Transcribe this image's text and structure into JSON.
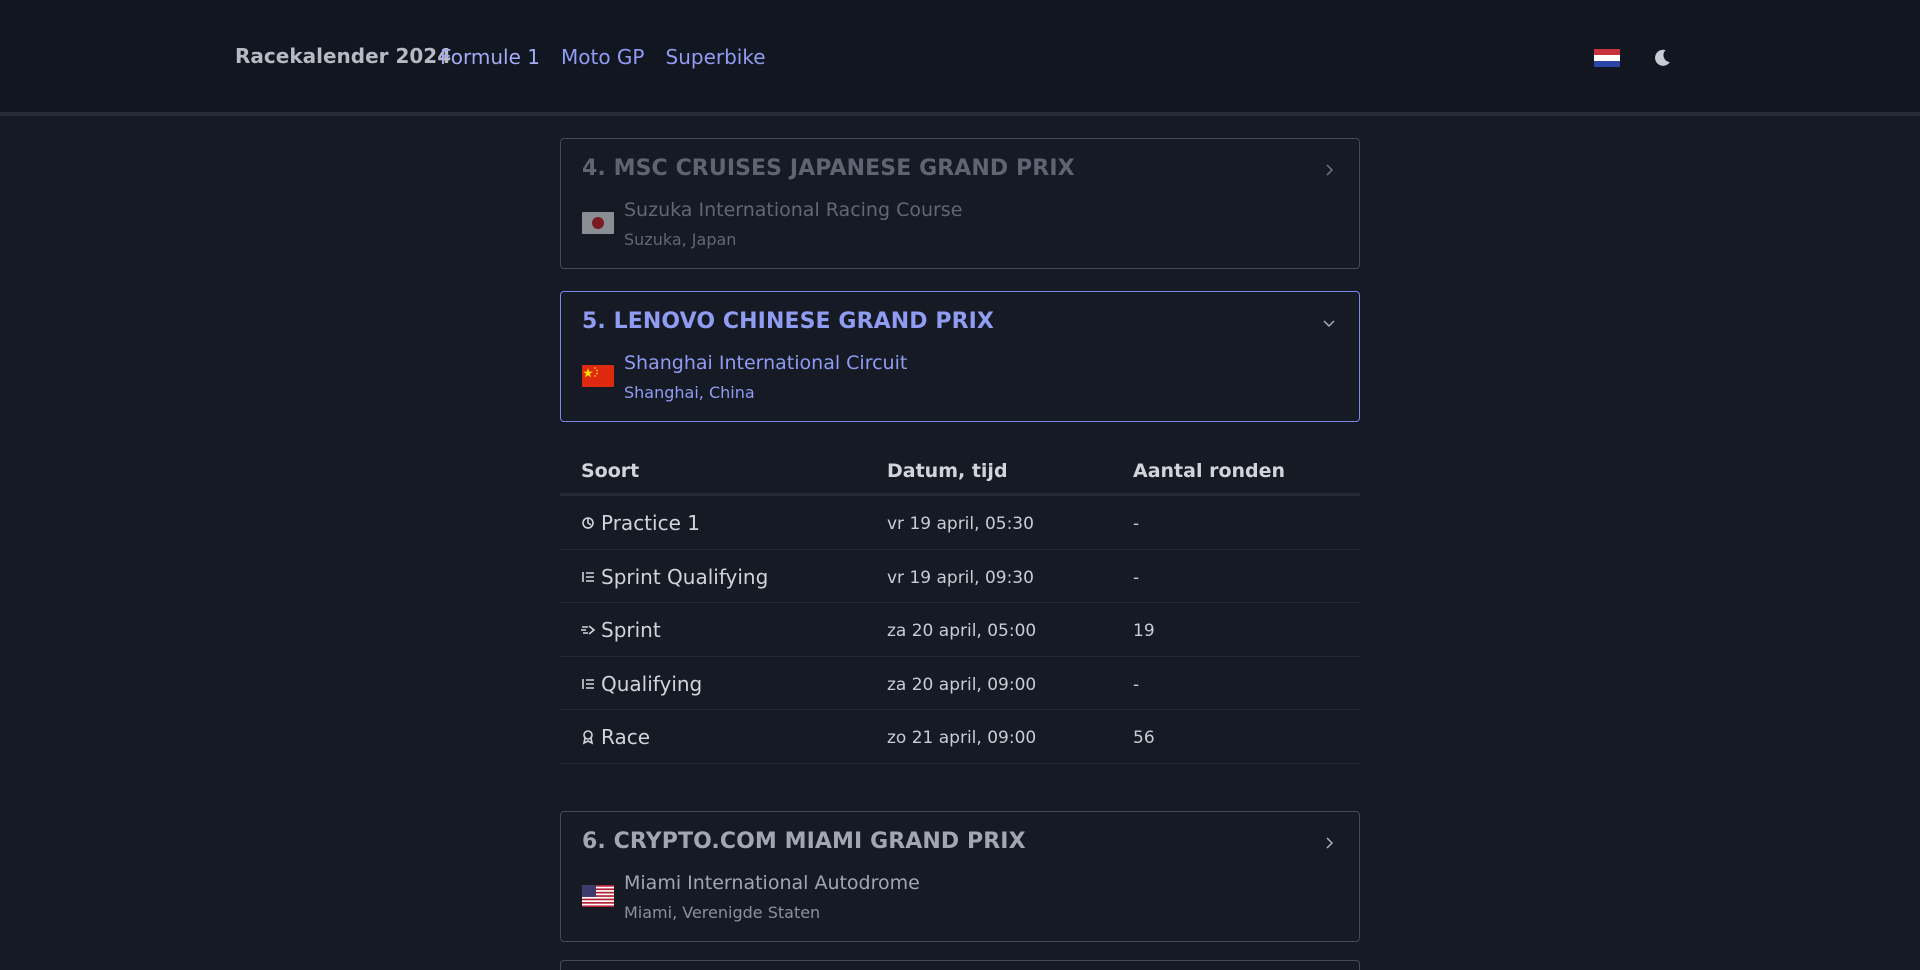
{
  "nav": {
    "brand": "Racekalender 2024",
    "links": [
      "Formule 1",
      "Moto GP",
      "Superbike"
    ],
    "language_flag": "netherlands-flag-icon",
    "theme_icon": "moon-icon"
  },
  "colors": {
    "background": "#161a25",
    "accent": "#8f9cf2",
    "card_border": "#444a59",
    "active_border": "#7d89e6"
  },
  "events": [
    {
      "title": "4. MSC CRUISES JAPANESE GRAND PRIX",
      "circuit": "Suzuka International Racing Course",
      "location": "Suzuka, Japan",
      "flag_icon": "japan-flag-icon",
      "state": "past",
      "chevron_icon": "chevron-right-icon"
    },
    {
      "title": "5. LENOVO CHINESE GRAND PRIX",
      "circuit": "Shanghai International Circuit",
      "location": "Shanghai, China",
      "flag_icon": "china-flag-icon",
      "state": "expanded",
      "chevron_icon": "chevron-down-icon"
    },
    {
      "title": "6. CRYPTO.COM MIAMI GRAND PRIX",
      "circuit": "Miami International Autodrome",
      "location": "Miami, Verenigde Staten",
      "flag_icon": "usa-flag-icon",
      "state": "upcoming",
      "chevron_icon": "chevron-right-icon"
    }
  ],
  "sessions": {
    "headers": [
      "Soort",
      "Datum, tijd",
      "Aantal ronden"
    ],
    "rows": [
      {
        "type": "Practice 1",
        "icon": "practice-icon",
        "date": "vr 19 april, 05:30",
        "laps": "-"
      },
      {
        "type": "Sprint Qualifying",
        "icon": "list-icon",
        "date": "vr 19 april, 09:30",
        "laps": "-"
      },
      {
        "type": "Sprint",
        "icon": "sprint-icon",
        "date": "za 20 april, 05:00",
        "laps": "19"
      },
      {
        "type": "Qualifying",
        "icon": "list-icon",
        "date": "za 20 april, 09:00",
        "laps": "-"
      },
      {
        "type": "Race",
        "icon": "trophy-icon",
        "date": "zo 21 april, 09:00",
        "laps": "56"
      }
    ]
  }
}
